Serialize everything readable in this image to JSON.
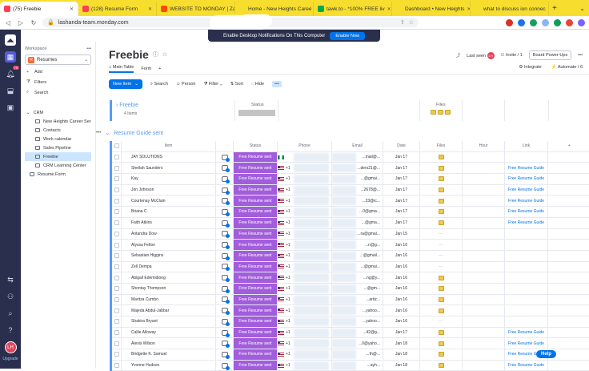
{
  "browser": {
    "tabs": [
      {
        "label": "(75) Freebie",
        "color": "#ff3d57",
        "active": true
      },
      {
        "label": "(128) Resume Form",
        "color": "#ff3d57"
      },
      {
        "label": "WEBSITE TO MONDAY | Za",
        "color": "#ff4a00"
      },
      {
        "label": "Home - New Heights Caree",
        "color": "#f7de2e"
      },
      {
        "label": "tawk.to - *100% FREE liv",
        "color": "#03a84e"
      },
      {
        "label": "Dashboard • New Heights",
        "color": "#f7de2e"
      },
      {
        "label": "what to discuss ion connec",
        "color": "#f7de2e"
      }
    ],
    "url": "lashanda-team.monday.com",
    "extension_colors": [
      "#d93025",
      "#1a73e8",
      "#17a05d",
      "#8ab4f8",
      "#0f9d58",
      "#ea4335",
      "#7b61ff"
    ]
  },
  "notification": {
    "text": "Enable Desktop Notifications On This Computer",
    "button": "Enable Now"
  },
  "sidebar": {
    "badge": "75",
    "avatar": "LH",
    "upgrade": "Upgrade"
  },
  "workspace": {
    "label": "Workspace",
    "name": "Resumes",
    "initial": "R",
    "actions": [
      "Add",
      "Filters",
      "Search"
    ],
    "folder": "CRM",
    "items": [
      "New Heights Career Ser...",
      "Contacts",
      "Work calendar",
      "Sales Pipeline",
      "Freebie",
      "CRM Learning Center"
    ],
    "form": "Resume Form"
  },
  "board": {
    "title": "Freebie",
    "last_seen": "Last seen",
    "invite": "Invite / 1",
    "power_ups": "Board Power-Ups",
    "views": [
      "Main Table",
      "Form"
    ],
    "integrate": "Integrate",
    "automate": "Automate / 6",
    "toolbar": {
      "new_item": "New Item",
      "search": "Search",
      "person": "Person",
      "filter": "Filter",
      "sort": "Sort",
      "hide": "Hide"
    }
  },
  "group1": {
    "name": "Freebie",
    "count": "4 Items",
    "status_col": "Status",
    "files_col": "Files"
  },
  "group2": {
    "name": "Resume Guide sent",
    "columns": [
      "Item",
      "Status",
      "Phone",
      "Email",
      "Date",
      "Files",
      "Hour",
      "Link"
    ],
    "rows": [
      {
        "item": "JAY SOLUTIONS",
        "status": "Free Resume sent",
        "phone": "",
        "flag": "ng",
        "email": "...mail@...",
        "date": "Jan 17",
        "file": true,
        "link": ""
      },
      {
        "item": "Sheilah Saunders",
        "status": "Free Resume sent",
        "phone": "+1",
        "flag": "us",
        "email": "...ders21@...",
        "date": "Jan 17",
        "file": true,
        "link": "Free Resume Guide"
      },
      {
        "item": "Kay",
        "status": "Free Resume sent",
        "phone": "+1",
        "flag": "us",
        "email": "...@gmai...",
        "date": "Jan 17",
        "file": true,
        "link": "Free Resume Guide"
      },
      {
        "item": "Jon Johnson",
        "status": "Free Resume sent",
        "phone": "+1",
        "flag": "us",
        "email": "...2678@...",
        "date": "Jan 17",
        "file": true,
        "link": "Free Resume Guide"
      },
      {
        "item": "Courtenay McClain",
        "status": "Free Resume sent",
        "phone": "+1",
        "flag": "us",
        "email": "...23@ic...",
        "date": "Jan 17",
        "file": true,
        "link": "Free Resume Guide"
      },
      {
        "item": "Briana C",
        "status": "Free Resume sent",
        "phone": "+1",
        "flag": "us",
        "email": "...0@gma...",
        "date": "Jan 17",
        "file": true,
        "link": "Free Resume Guide"
      },
      {
        "item": "Faith Atkins",
        "status": "Free Resume sent",
        "phone": "+1",
        "flag": "us",
        "email": "...@gma...",
        "date": "Jan 17",
        "file": true,
        "link": "Free Resume Guide"
      },
      {
        "item": "Antandra Dow",
        "status": "Free Resume sent",
        "phone": "+1",
        "flag": "us",
        "email": "...ra@gmai...",
        "date": "Jan 15",
        "file": false,
        "link": ""
      },
      {
        "item": "Alyssa Felton",
        "status": "Free Resume sent",
        "phone": "+1",
        "flag": "us",
        "email": "...n@g...",
        "date": "Jan 16",
        "file": false,
        "link": ""
      },
      {
        "item": "Sebastian Higgins",
        "status": "Free Resume sent",
        "phone": "+1",
        "flag": "us",
        "email": "...@gmail...",
        "date": "Jan 16",
        "file": false,
        "link": ""
      },
      {
        "item": "Zell Dempa",
        "status": "Free Resume sent",
        "phone": "+1",
        "flag": "us",
        "email": "...@gmai...",
        "date": "Jan 16",
        "file": false,
        "link": ""
      },
      {
        "item": "Abigail Edemidiong",
        "status": "Free Resume sent",
        "phone": "+1",
        "flag": "us",
        "email": "...ng@y...",
        "date": "Jan 16",
        "file": true,
        "link": ""
      },
      {
        "item": "Shontay Thompson",
        "status": "Free Resume sent",
        "phone": "+1",
        "flag": "us",
        "email": "...@gm...",
        "date": "Jan 16",
        "file": true,
        "link": ""
      },
      {
        "item": "Maritza Cumbo",
        "status": "Free Resume sent",
        "phone": "+1",
        "flag": "us",
        "email": "...aritz...",
        "date": "Jan 16",
        "file": true,
        "link": ""
      },
      {
        "item": "Majeda Abdul-Jabbar",
        "status": "Free Resume sent",
        "phone": "+1",
        "flag": "us",
        "email": "...yahoo...",
        "date": "Jan 16",
        "file": true,
        "link": ""
      },
      {
        "item": "Shakira Bryant",
        "status": "Free Resume sent",
        "phone": "+1",
        "flag": "us",
        "email": "...yahoo...",
        "date": "Jan 16",
        "file": false,
        "link": ""
      },
      {
        "item": "Callie Alloway",
        "status": "Free Resume sent",
        "phone": "+1",
        "flag": "us",
        "email": "...42@g...",
        "date": "Jan 17",
        "file": true,
        "link": "Free Resume Guide"
      },
      {
        "item": "Alexis Wilson",
        "status": "Free Resume sent",
        "phone": "+1",
        "flag": "us",
        "email": "...0@yaho...",
        "date": "Jan 18",
        "file": true,
        "link": "Free Resume Guide"
      },
      {
        "item": "Bridgette K. Samuel",
        "status": "Free Resume sent",
        "phone": "+1",
        "flag": "us",
        "email": "...th@...",
        "date": "Jan 18",
        "file": true,
        "link": "Free Resume Guide"
      },
      {
        "item": "Yvonne Hudson",
        "status": "Free Resume sent",
        "phone": "+1",
        "flag": "us",
        "email": "...ayh...",
        "date": "Jan 18",
        "file": true,
        "link": "Free Resume Guide"
      }
    ]
  },
  "help": "Help",
  "colors": {
    "accent": "#0073ea",
    "status": "#a25ddc",
    "group": "#579bfc",
    "sidebar": "#292f4c"
  }
}
